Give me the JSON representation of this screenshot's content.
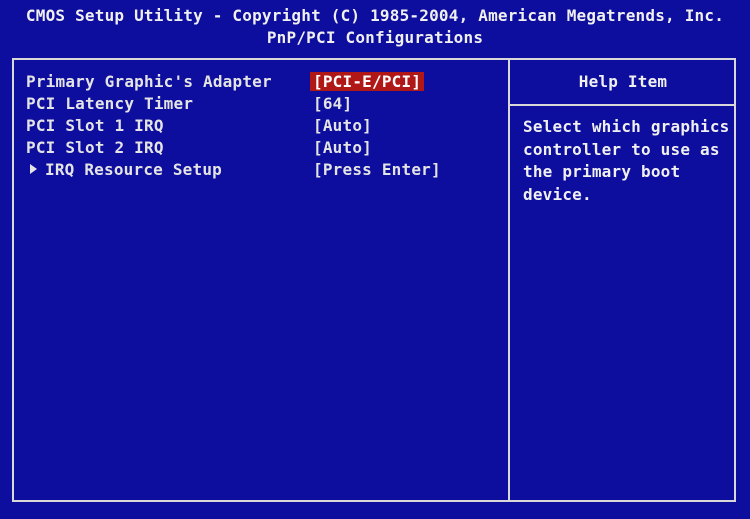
{
  "header": {
    "title": "CMOS Setup Utility - Copyright (C) 1985-2004, American Megatrends, Inc.",
    "subtitle": "PnP/PCI Configurations"
  },
  "settings": [
    {
      "label": "Primary Graphic's Adapter",
      "value": "[PCI-E/PCI]",
      "selected": true
    },
    {
      "label": "PCI Latency Timer",
      "value": "[64]"
    },
    {
      "label": "PCI Slot 1 IRQ",
      "value": "[Auto]"
    },
    {
      "label": "PCI Slot 2 IRQ",
      "value": "[Auto]"
    },
    {
      "label": "IRQ Resource Setup",
      "value": "[Press Enter]",
      "submenu": true
    }
  ],
  "help": {
    "title": "Help Item",
    "text": "Select which graphics\ncontroller to use as\nthe primary boot\ndevice."
  },
  "colors": {
    "background": "#0d0d9e",
    "text": "#e4e4e4",
    "highlight": "#b01818"
  }
}
